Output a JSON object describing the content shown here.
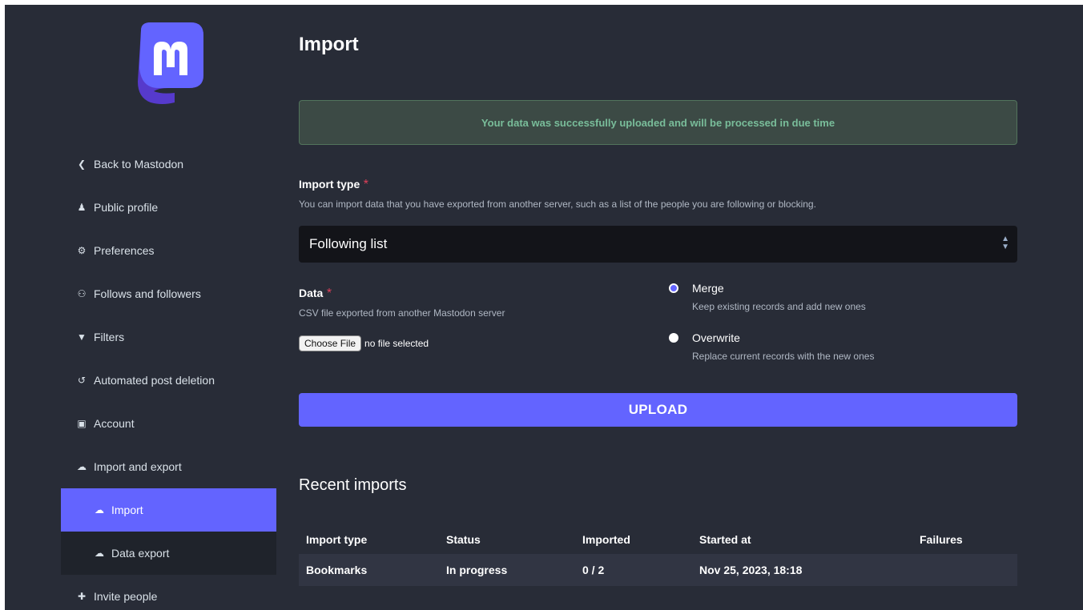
{
  "app": {
    "logo": "mastodon-logo"
  },
  "sidebar": {
    "items": [
      {
        "label": "Back to Mastodon",
        "icon": "chevron-left-icon",
        "glyph": "❮"
      },
      {
        "label": "Public profile",
        "icon": "user-icon",
        "glyph": "♟"
      },
      {
        "label": "Preferences",
        "icon": "gear-icon",
        "glyph": "⚙"
      },
      {
        "label": "Follows and followers",
        "icon": "users-icon",
        "glyph": "⚇"
      },
      {
        "label": "Filters",
        "icon": "filter-icon",
        "glyph": "▼"
      },
      {
        "label": "Automated post deletion",
        "icon": "history-icon",
        "glyph": "↺"
      },
      {
        "label": "Account",
        "icon": "lock-icon",
        "glyph": "▣"
      },
      {
        "label": "Import and export",
        "icon": "cloud-icon",
        "glyph": "☁"
      }
    ],
    "subitems": [
      {
        "label": "Import",
        "icon": "cloud-upload-icon",
        "glyph": "☁",
        "active": true
      },
      {
        "label": "Data export",
        "icon": "cloud-download-icon",
        "glyph": "☁",
        "active": false
      }
    ],
    "last": {
      "label": "Invite people",
      "icon": "user-plus-icon",
      "glyph": "✚"
    }
  },
  "main": {
    "title": "Import",
    "flash": "Your data was successfully uploaded and will be processed in due time",
    "import_type": {
      "label": "Import type",
      "required_mark": "*",
      "hint": "You can import data that you have exported from another server, such as a list of the people you are following or blocking.",
      "selected": "Following list"
    },
    "data": {
      "label": "Data",
      "required_mark": "*",
      "hint": "CSV file exported from another Mastodon server",
      "file_button": "Choose File",
      "file_status": "no file selected"
    },
    "mode": {
      "options": [
        {
          "label": "Merge",
          "hint": "Keep existing records and add new ones",
          "checked": true
        },
        {
          "label": "Overwrite",
          "hint": "Replace current records with the new ones",
          "checked": false
        }
      ]
    },
    "upload_label": "UPLOAD",
    "recent": {
      "title": "Recent imports",
      "columns": [
        "Import type",
        "Status",
        "Imported",
        "Started at",
        "Failures"
      ],
      "rows": [
        {
          "type": "Bookmarks",
          "status": "In progress",
          "imported": "0 / 2",
          "started": "Nov 25, 2023, 18:18",
          "failures": ""
        }
      ]
    }
  },
  "colors": {
    "accent": "#6364ff",
    "background": "#282c37",
    "success": "#79bd9a"
  }
}
